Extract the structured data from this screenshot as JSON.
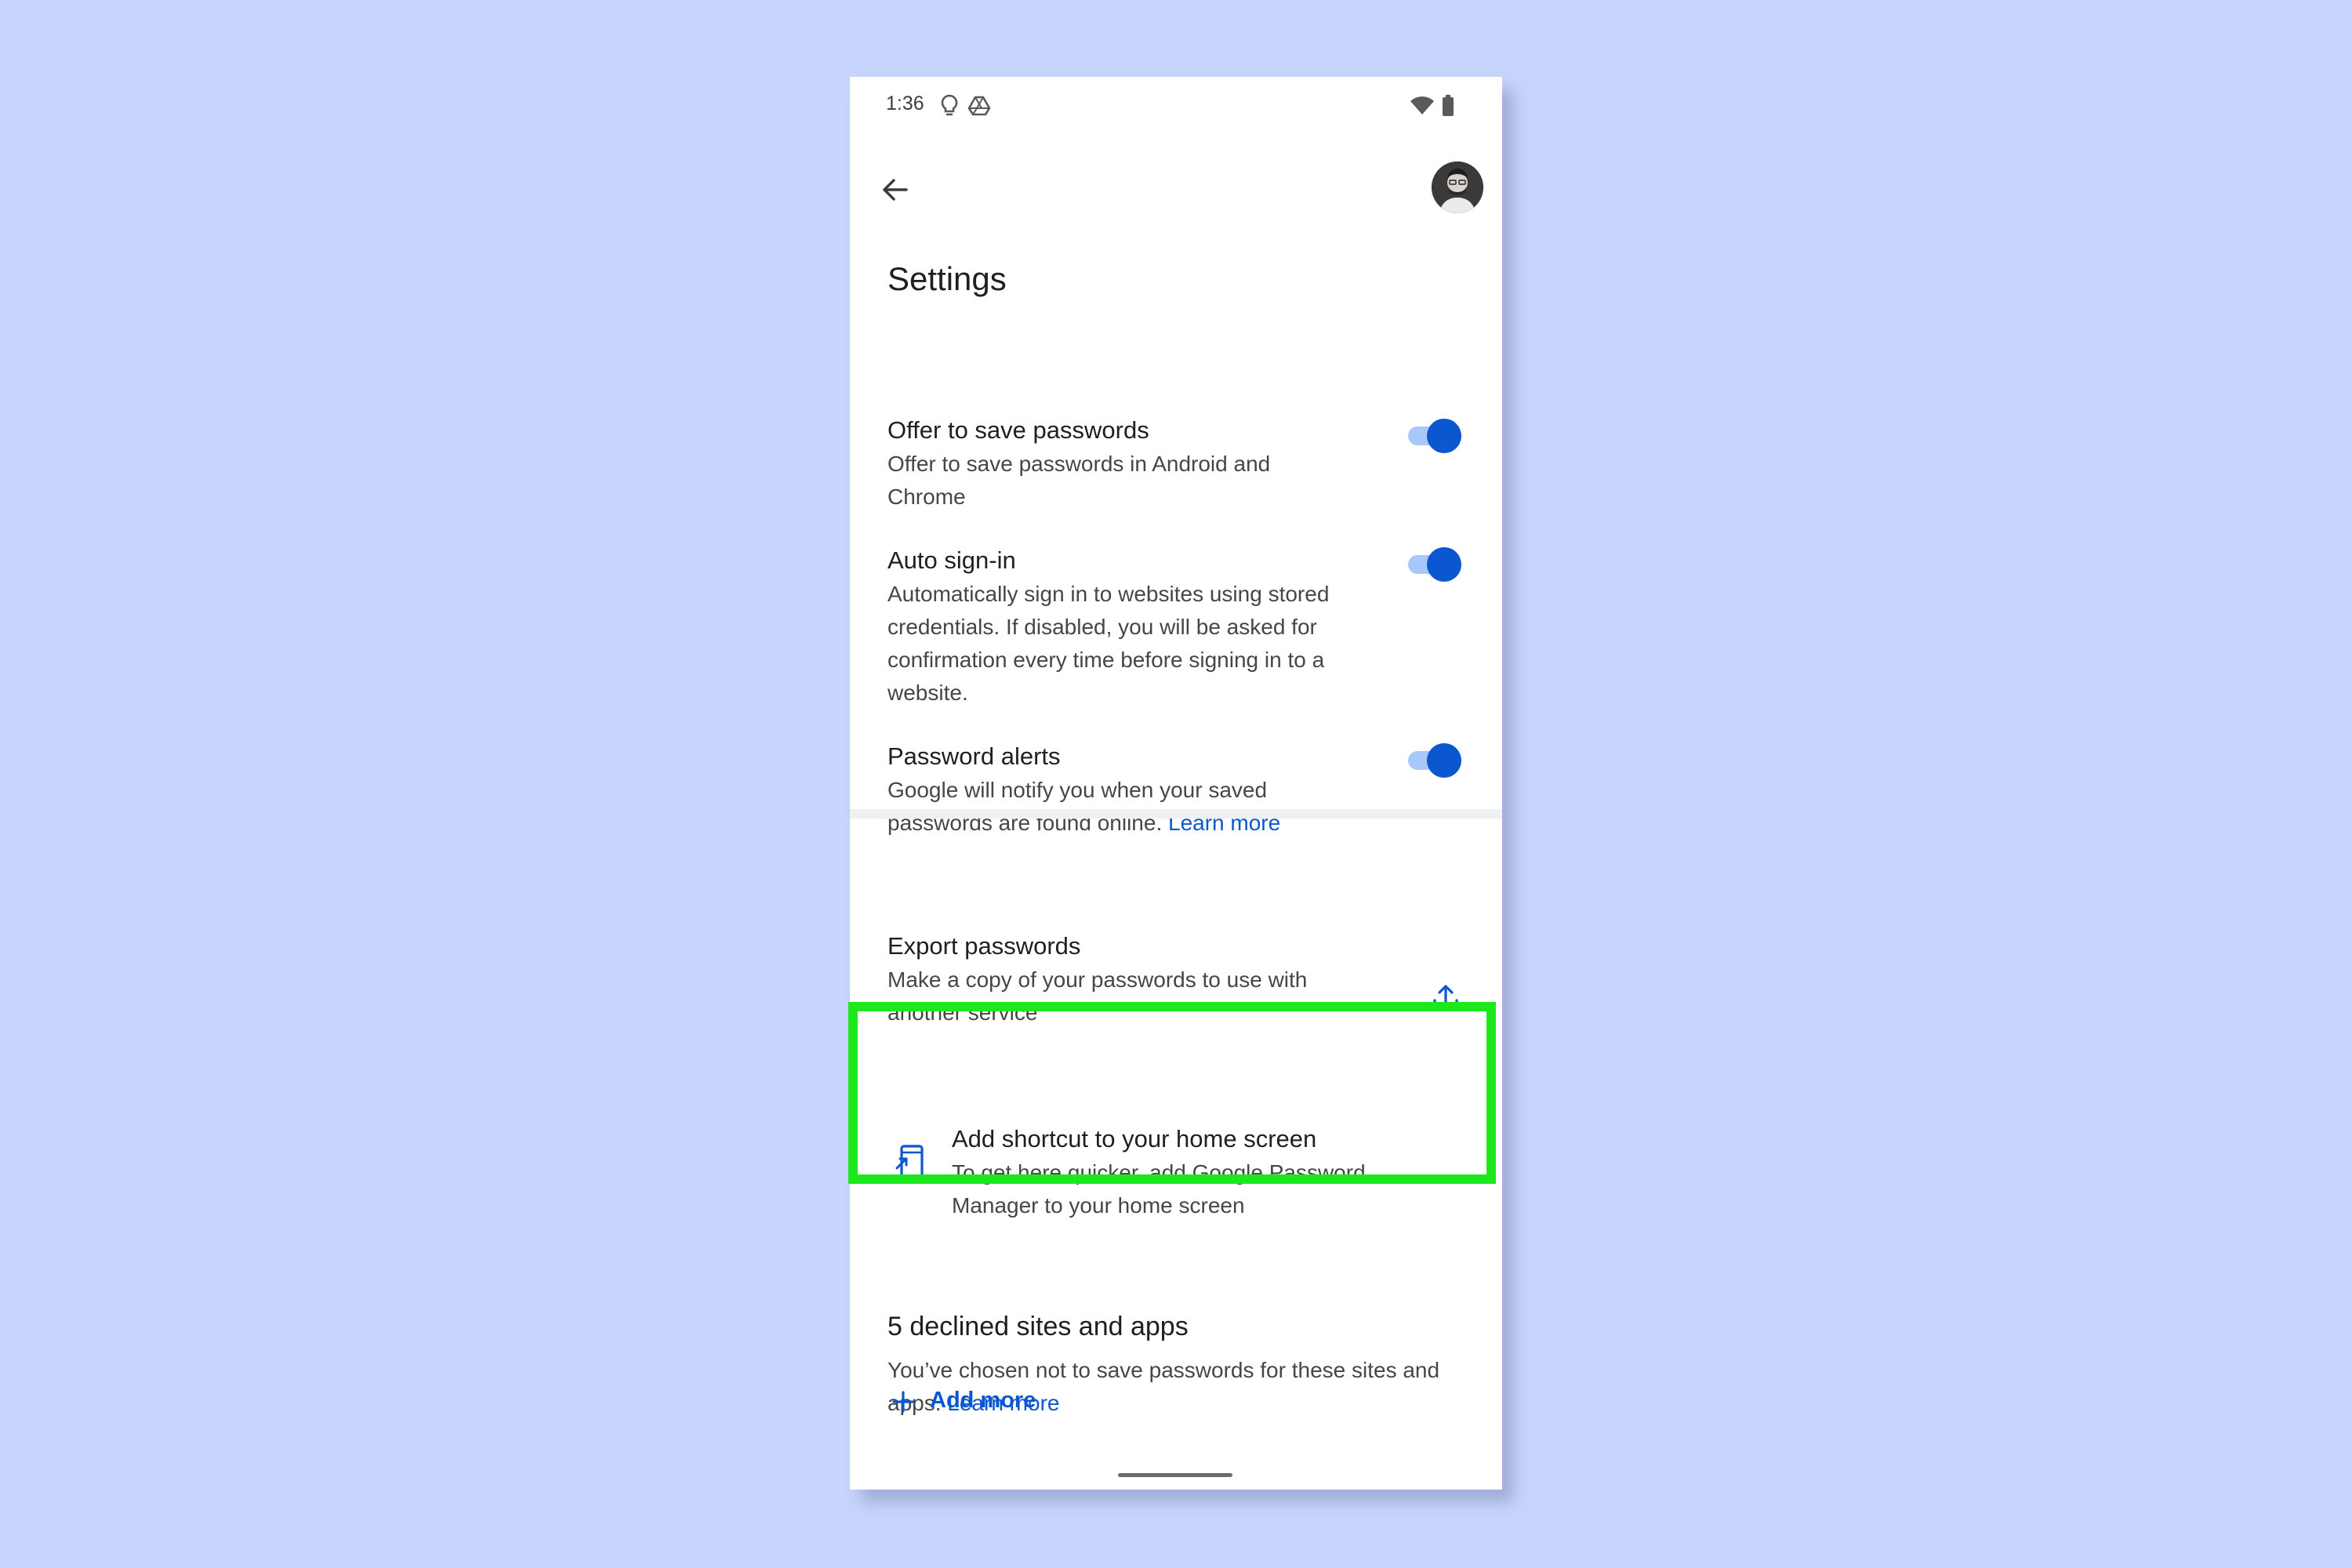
{
  "status_bar": {
    "time": "1:36",
    "left_icons": [
      "lightbulb-icon",
      "drive-icon"
    ],
    "right_icons": [
      "wifi-icon",
      "battery-icon"
    ]
  },
  "header": {
    "back_icon": "arrow-back-icon",
    "avatar": "profile-avatar"
  },
  "page_title": "Settings",
  "settings": [
    {
      "title": "Offer to save passwords",
      "description": "Offer to save passwords in Android and Chrome",
      "enabled": true
    },
    {
      "title": "Auto sign-in",
      "description": "Automatically sign in to websites using stored credentials. If disabled, you will be asked for confirmation every time before signing in to a website.",
      "enabled": true
    },
    {
      "title": "Password alerts",
      "description": "Google will notify you when your saved passwords are found online.",
      "link": "Learn more",
      "enabled": true
    }
  ],
  "export": {
    "title": "Export passwords",
    "description": "Make a copy of your passwords to use with another service",
    "icon": "upload-icon"
  },
  "shortcut": {
    "title": "Add shortcut to your home screen",
    "description": "To get here quicker, add Google Password Manager to your home screen",
    "icon": "add-to-home-screen-icon"
  },
  "declined": {
    "title": "5 declined sites and apps",
    "description": "You’ve chosen not to save passwords for these sites and apps.",
    "link": "Learn more",
    "add_more": "Add more"
  },
  "colors": {
    "background": "#c7d5fc",
    "accent": "#0b57d0",
    "toggle_track": "#a8c7fa",
    "highlight": "#1ce81c"
  }
}
